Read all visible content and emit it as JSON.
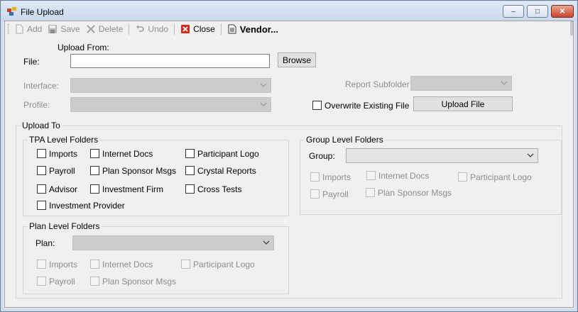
{
  "window": {
    "title": "File Upload",
    "controls": {
      "minimize": "–",
      "maximize": "□",
      "close": "✕"
    }
  },
  "toolbar": {
    "add": "Add",
    "save": "Save",
    "delete": "Delete",
    "undo": "Undo",
    "close": "Close",
    "vendor": "Vendor..."
  },
  "upload_from": {
    "heading": "Upload From:",
    "file_label": "File:",
    "file_value": "",
    "browse": "Browse",
    "interface_label": "Interface:",
    "interface_value": "",
    "profile_label": "Profile:",
    "profile_value": "",
    "report_subfolder_label": "Report Subfolder",
    "report_subfolder_value": "",
    "overwrite_label": "Overwrite Existing File",
    "upload_file": "Upload File"
  },
  "upload_to": {
    "heading": "Upload To",
    "tpa": {
      "title": "TPA Level Folders",
      "items": [
        "Imports",
        "Internet Docs",
        "Participant Logo",
        "Payroll",
        "Plan Sponsor Msgs",
        "Crystal Reports",
        "Advisor",
        "Investment Firm",
        "Cross Tests",
        "Investment Provider"
      ]
    },
    "plan": {
      "title": "Plan Level Folders",
      "plan_label": "Plan:",
      "plan_value": "",
      "items": [
        "Imports",
        "Internet Docs",
        "Participant Logo",
        "Payroll",
        "Plan Sponsor Msgs"
      ]
    },
    "group": {
      "title": "Group Level Folders",
      "group_label": "Group:",
      "group_value": "",
      "items": [
        "Imports",
        "Internet Docs",
        "Participant Logo",
        "Payroll",
        "Plan Sponsor Msgs"
      ]
    }
  }
}
